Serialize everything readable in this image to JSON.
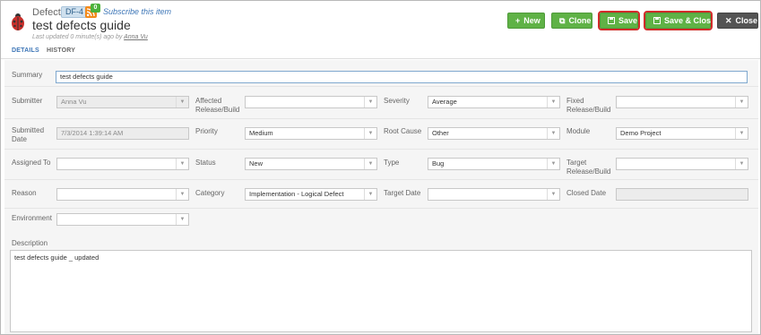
{
  "header": {
    "entity_type": "Defect",
    "id": "DF-4",
    "rss_count": "0",
    "subscribe_text": "Subscribe this item",
    "title": "test defects guide",
    "updated_prefix": "Last updated 0 minute(s) ago by ",
    "updated_user": "Anna Vu"
  },
  "toolbar": {
    "new_label": "New",
    "clone_label": "Clone",
    "save_label": "Save",
    "save_close_label": "Save & Close",
    "close_label": "Close"
  },
  "tabs": {
    "details": "DETAILS",
    "history": "HISTORY"
  },
  "form": {
    "summary": {
      "label": "Summary",
      "value": "test defects guide"
    },
    "submitter": {
      "label": "Submitter",
      "value": "Anna Vu"
    },
    "affected_release": {
      "label": "Affected Release/Build",
      "value": ""
    },
    "severity": {
      "label": "Severity",
      "value": "Average"
    },
    "fixed_release": {
      "label": "Fixed Release/Build",
      "value": ""
    },
    "submitted_date": {
      "label": "Submitted Date",
      "value": "7/3/2014 1:39:14 AM"
    },
    "priority": {
      "label": "Priority",
      "value": "Medium"
    },
    "root_cause": {
      "label": "Root Cause",
      "value": "Other"
    },
    "module": {
      "label": "Module",
      "value": "Demo Project"
    },
    "assigned_to": {
      "label": "Assigned To",
      "value": ""
    },
    "status": {
      "label": "Status",
      "value": "New"
    },
    "type": {
      "label": "Type",
      "value": "Bug"
    },
    "target_release": {
      "label": "Target Release/Build",
      "value": ""
    },
    "reason": {
      "label": "Reason",
      "value": ""
    },
    "category": {
      "label": "Category",
      "value": "Implementation - Logical Defect"
    },
    "target_date": {
      "label": "Target Date",
      "value": ""
    },
    "closed_date": {
      "label": "Closed Date",
      "value": ""
    },
    "environment": {
      "label": "Environment",
      "value": ""
    },
    "description": {
      "label": "Description",
      "value": "test defects guide _ updated"
    }
  },
  "colors": {
    "primary_button": "#5fb246",
    "close_button": "#545454",
    "link": "#3d76b7",
    "highlight": "#d32b2b"
  }
}
